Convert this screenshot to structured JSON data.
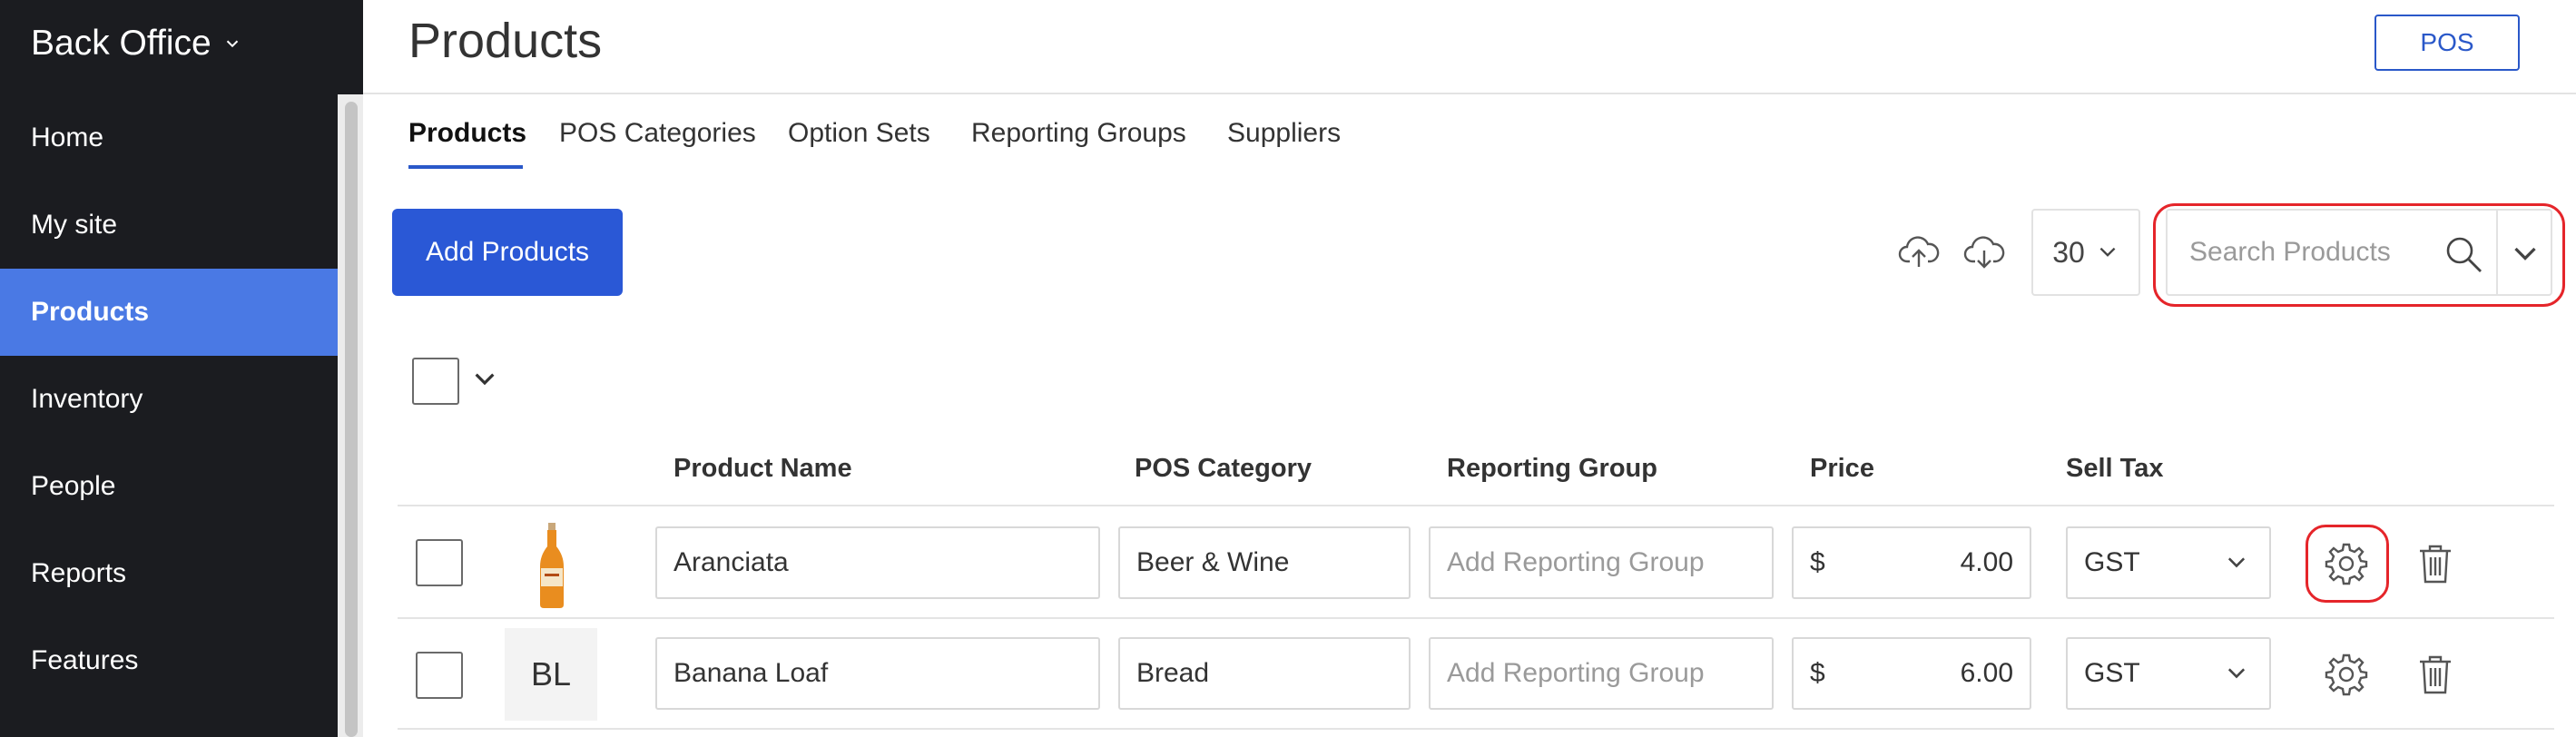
{
  "sidebar": {
    "brand": "Back Office",
    "items": [
      {
        "label": "Home"
      },
      {
        "label": "My site"
      },
      {
        "label": "Products"
      },
      {
        "label": "Inventory"
      },
      {
        "label": "People"
      },
      {
        "label": "Reports"
      },
      {
        "label": "Features"
      }
    ],
    "active": "Products"
  },
  "header": {
    "title": "Products",
    "pos_button": "POS"
  },
  "tabs": [
    {
      "label": "Products"
    },
    {
      "label": "POS Categories"
    },
    {
      "label": "Option Sets"
    },
    {
      "label": "Reporting Groups"
    },
    {
      "label": "Suppliers"
    }
  ],
  "toolbar": {
    "add_label": "Add Products",
    "page_size": "30",
    "search_placeholder": "Search Products"
  },
  "table": {
    "columns": [
      "Product Name",
      "POS Category",
      "Reporting Group",
      "Price",
      "Sell Tax"
    ],
    "reporting_group_placeholder": "Add Reporting Group",
    "currency": "$",
    "rows": [
      {
        "name": "Aranciata",
        "category": "Beer & Wine",
        "price": "4.00",
        "tax": "GST",
        "thumb": ""
      },
      {
        "name": "Banana Loaf",
        "category": "Bread",
        "price": "6.00",
        "tax": "GST",
        "thumb": "BL"
      }
    ]
  },
  "colors": {
    "sidebar_bg": "#1b1c20",
    "active_nav": "#4a79e4",
    "primary": "#2a58d6",
    "highlight": "#e5252a"
  }
}
